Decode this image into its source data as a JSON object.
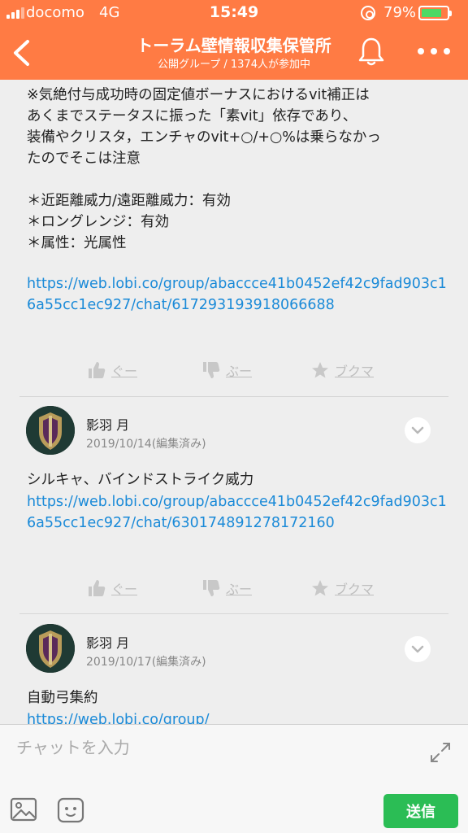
{
  "status_bar": {
    "carrier": "docomo",
    "network": "4G",
    "time": "15:49",
    "battery_pct": "79%",
    "battery_level": 0.79,
    "battery_color": "#4cd964"
  },
  "header": {
    "title": "トーラム壁情報収集保管所",
    "subtitle": "公開グループ / 1374人が参加中",
    "icons": [
      "back-icon",
      "bell-icon",
      "more-icon"
    ],
    "background": "#ff7b44"
  },
  "messages": [
    {
      "text": "※気絶付与成功時の固定値ボーナスにおけるvit補正は\nあくまでステータスに振った「素vit」依存であり、\n装備やクリスタ，エンチャのvit+○/+○%は乗らなかっ\nたのでそこは注意\n\n＊近距離威力/遠距離威力：有効\n＊ロングレンジ：有効\n＊属性：光属性",
      "link": "https://web.lobi.co/group/abaccce41b0452ef42c9fad903c16a55cc1ec927/chat/617293193918066688",
      "actions": {
        "like": "ぐー",
        "dislike": "ぶー",
        "bookmark": "ブクマ"
      }
    },
    {
      "author": "影羽 月",
      "date": "2019/10/14(編集済み)",
      "text": "シルキャ、バインドストライク威力",
      "link": "https://web.lobi.co/group/abaccce41b0452ef42c9fad903c16a55cc1ec927/chat/630174891278172160",
      "actions": {
        "like": "ぐー",
        "dislike": "ぶー",
        "bookmark": "ブクマ"
      }
    },
    {
      "author": "影羽 月",
      "date": "2019/10/17(編集済み)",
      "text": "自動弓集約",
      "link": "https://web.lobi.co/group/"
    }
  ],
  "input": {
    "placeholder": "チャットを入力",
    "send_label": "送信",
    "icons": [
      "expand-icon",
      "image-icon",
      "sticker-icon"
    ]
  },
  "colors": {
    "link": "#1a8ad8",
    "send": "#2bbd55",
    "chat_bg": "#eeeeee"
  }
}
